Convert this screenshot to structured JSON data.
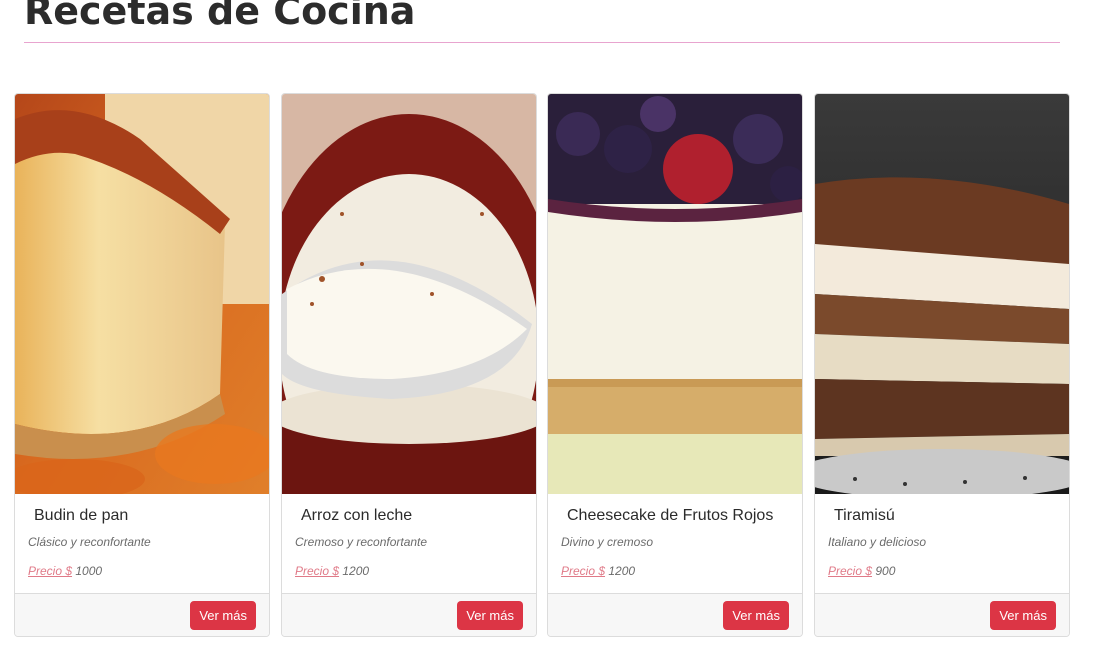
{
  "header": {
    "title": "Recetas de Cocina",
    "rule_color": "#e8a4cf"
  },
  "recipes": [
    {
      "title": "Budin de pan",
      "subtitle": "Clásico y reconfortante",
      "price_label": "Precio $",
      "price": "1000",
      "button_label": "Ver más",
      "image": "budin-de-pan-photo"
    },
    {
      "title": "Arroz con leche",
      "subtitle": "Cremoso y reconfortante",
      "price_label": "Precio $",
      "price": "1200",
      "button_label": "Ver más",
      "image": "arroz-con-leche-photo"
    },
    {
      "title": "Cheesecake de Frutos Rojos",
      "subtitle": "Divino y cremoso",
      "price_label": "Precio $",
      "price": "1200",
      "button_label": "Ver más",
      "image": "cheesecake-photo"
    },
    {
      "title": "Tiramisú",
      "subtitle": "Italiano y delicioso",
      "price_label": "Precio $",
      "price": "900",
      "button_label": "Ver más",
      "image": "tiramisu-photo"
    }
  ],
  "colors": {
    "button": "#dc3545",
    "price_link": "#e07a88",
    "footer_bg": "#f7f7f7"
  }
}
